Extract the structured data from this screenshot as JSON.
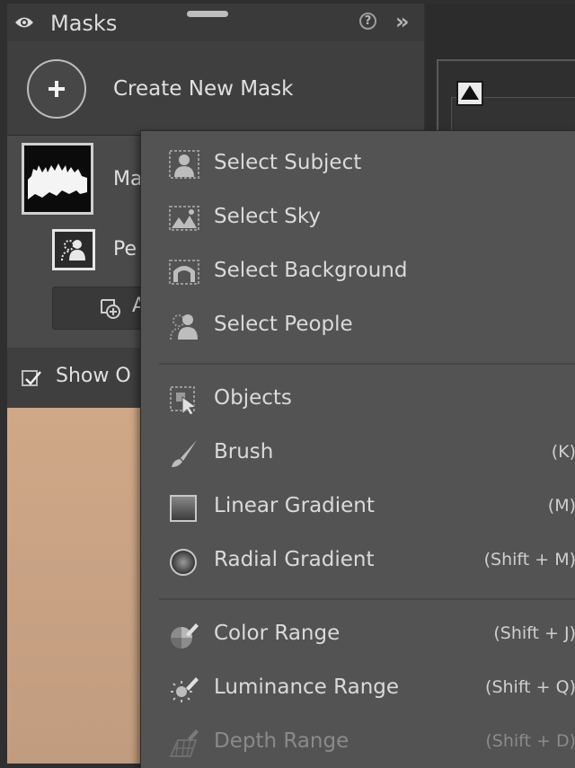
{
  "panel": {
    "title": "Masks",
    "help_icon": "help-circle-icon",
    "help_glyph": "?",
    "expand_icon": "double-chevron-right-icon",
    "expand_glyph": "»",
    "create_label": "Create New Mask",
    "mask_name": "Ma",
    "people_name": "Pe",
    "add_label": "A",
    "show_overlay_label": "Show O",
    "show_overlay_checked": true
  },
  "menu": {
    "groups": [
      [
        {
          "label": "Select Subject",
          "icon": "select-subject-icon",
          "shortcut": ""
        },
        {
          "label": "Select Sky",
          "icon": "select-sky-icon",
          "shortcut": ""
        },
        {
          "label": "Select Background",
          "icon": "select-background-icon",
          "shortcut": ""
        },
        {
          "label": "Select People",
          "icon": "select-people-icon",
          "shortcut": ""
        }
      ],
      [
        {
          "label": "Objects",
          "icon": "objects-icon",
          "shortcut": ""
        },
        {
          "label": "Brush",
          "icon": "brush-icon",
          "shortcut": "(K)"
        },
        {
          "label": "Linear Gradient",
          "icon": "linear-gradient-icon",
          "shortcut": "(M)"
        },
        {
          "label": "Radial Gradient",
          "icon": "radial-gradient-icon",
          "shortcut": "(Shift + M)"
        }
      ],
      [
        {
          "label": "Color Range",
          "icon": "color-range-icon",
          "shortcut": "(Shift + J)"
        },
        {
          "label": "Luminance Range",
          "icon": "luminance-range-icon",
          "shortcut": "(Shift + Q)"
        },
        {
          "label": "Depth Range",
          "icon": "depth-range-icon",
          "shortcut": "(Shift + D)",
          "disabled": true
        }
      ]
    ]
  }
}
